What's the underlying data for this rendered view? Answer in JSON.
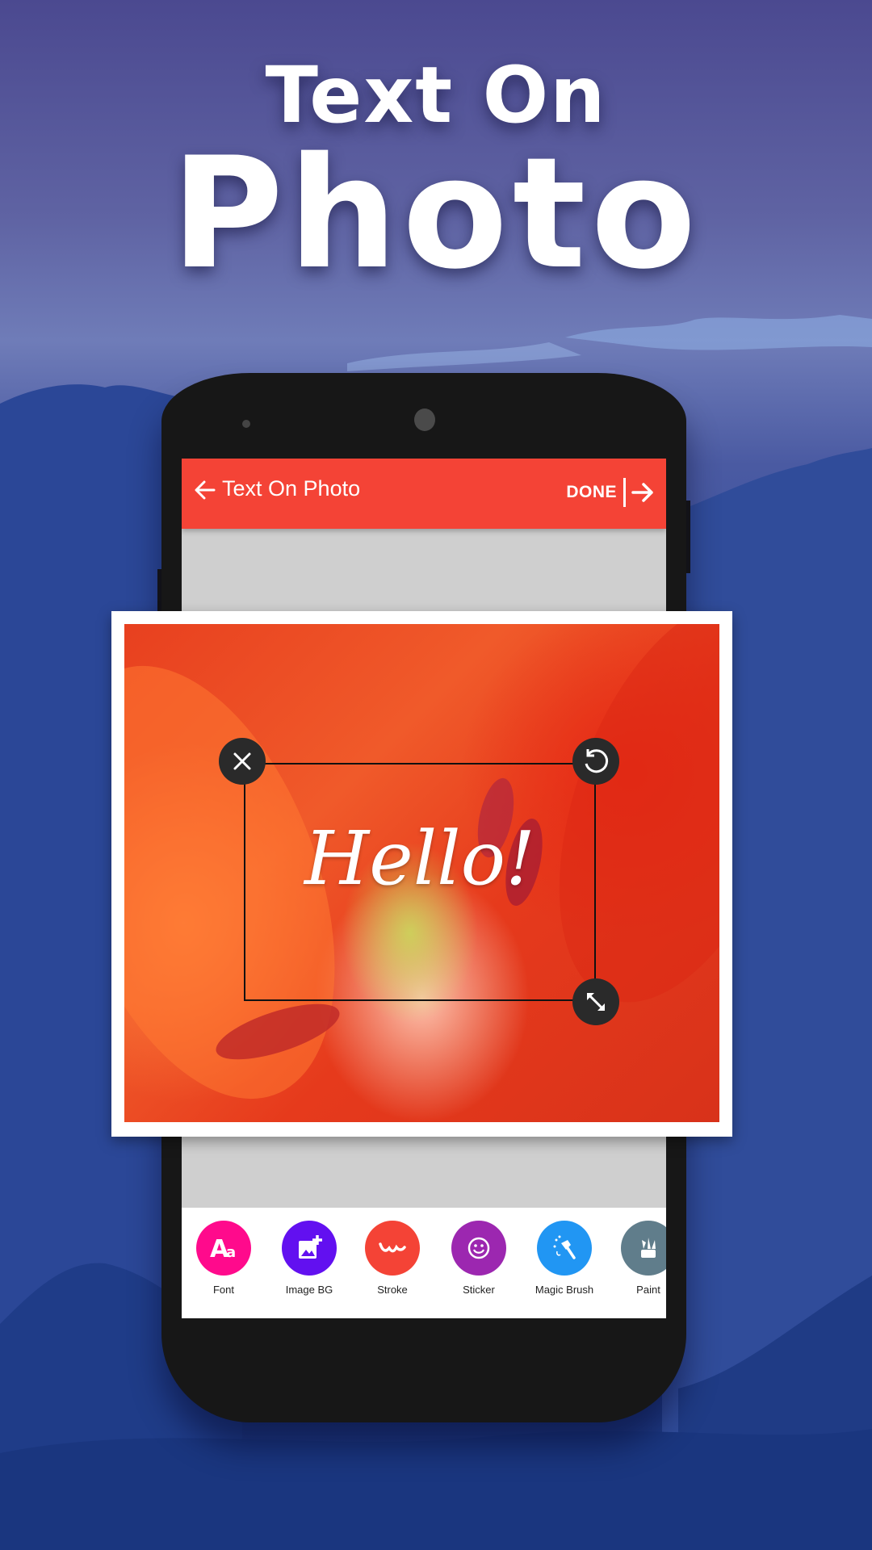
{
  "headline": {
    "line1": "Text On",
    "line2": "Photo"
  },
  "app_bar": {
    "title": "Text On Photo",
    "done_label": "DONE",
    "background": "#f44336"
  },
  "canvas": {
    "text_content": "Hello!",
    "text_color": "#ffffff"
  },
  "toolbar": {
    "items": [
      {
        "label": "Font",
        "icon": "font-icon",
        "color": "#ff0a8c"
      },
      {
        "label": "Image BG",
        "icon": "add-image-icon",
        "color": "#6210f0"
      },
      {
        "label": "Stroke",
        "icon": "stroke-icon",
        "color": "#f44336"
      },
      {
        "label": "Sticker",
        "icon": "smiley-icon",
        "color": "#9c27b0"
      },
      {
        "label": "Magic Brush",
        "icon": "magic-brush-icon",
        "color": "#2196f3"
      },
      {
        "label": "Paint",
        "icon": "paint-icon",
        "color": "#607d8b"
      }
    ]
  }
}
